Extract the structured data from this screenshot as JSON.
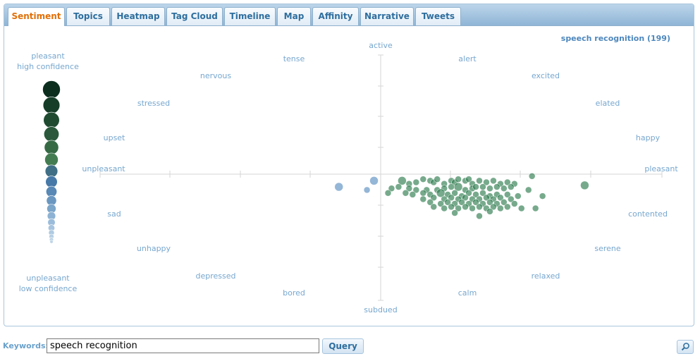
{
  "tabs": [
    {
      "label": "Sentiment",
      "active": true
    },
    {
      "label": "Topics"
    },
    {
      "label": "Heatmap"
    },
    {
      "label": "Tag Cloud"
    },
    {
      "label": "Timeline"
    },
    {
      "label": "Map"
    },
    {
      "label": "Affinity"
    },
    {
      "label": "Narrative"
    },
    {
      "label": "Tweets"
    }
  ],
  "legend": {
    "title": "speech recognition (199)",
    "top_line1": "pleasant",
    "top_line2": "high confidence",
    "bottom_line1": "unpleasant",
    "bottom_line2": "low confidence",
    "colors_pleasant_to_unpleasant": [
      "#0c2e1f",
      "#163d28",
      "#1f4b31",
      "#2a5a3b",
      "#366a45",
      "#447c52",
      "#3f6f86",
      "#4679a8",
      "#5888b5",
      "#6a97c0",
      "#7ca5ca",
      "#8db2d3",
      "#9bbddb",
      "#a6c4df",
      "#afcae2",
      "#b6cfe4",
      "#bbd2e6",
      "#bfd5e8"
    ]
  },
  "emotion_labels": {
    "active": "active",
    "subdued": "subdued",
    "pleasant": "pleasant",
    "unpleasant": "unpleasant",
    "tense": "tense",
    "nervous": "nervous",
    "stressed": "stressed",
    "upset": "upset",
    "sad": "sad",
    "unhappy": "unhappy",
    "depressed": "depressed",
    "bored": "bored",
    "alert": "alert",
    "excited": "excited",
    "elated": "elated",
    "happy": "happy",
    "contented": "contented",
    "serene": "serene",
    "relaxed": "relaxed",
    "calm": "calm"
  },
  "chart_data": {
    "type": "scatter",
    "title": "speech recognition (199)",
    "xlabel": "",
    "ylabel": "",
    "xlim": [
      1,
      9
    ],
    "ylim": [
      1,
      9
    ],
    "grid": false,
    "point_count": 199,
    "series": [
      {
        "name": "pleasant",
        "color": "#2e7d4f",
        "points": [
          [
            5.3,
            4.9,
            2
          ],
          [
            5.4,
            4.8,
            1
          ],
          [
            5.5,
            4.85,
            1
          ],
          [
            5.6,
            4.95,
            1
          ],
          [
            5.7,
            4.9,
            1
          ],
          [
            5.75,
            4.85,
            1
          ],
          [
            5.8,
            4.95,
            1
          ],
          [
            5.9,
            4.8,
            1
          ],
          [
            6.0,
            4.9,
            1
          ],
          [
            6.05,
            4.85,
            1
          ],
          [
            6.1,
            4.95,
            1
          ],
          [
            6.2,
            4.9,
            1
          ],
          [
            6.25,
            4.95,
            1
          ],
          [
            6.3,
            4.8,
            1
          ],
          [
            6.4,
            4.9,
            1
          ],
          [
            6.5,
            4.85,
            1
          ],
          [
            6.6,
            4.9,
            1
          ],
          [
            6.7,
            4.8,
            1
          ],
          [
            6.8,
            4.85,
            1
          ],
          [
            6.9,
            4.8,
            1
          ],
          [
            5.9,
            4.65,
            1
          ],
          [
            6.0,
            4.7,
            1
          ],
          [
            6.1,
            4.7,
            2
          ],
          [
            6.2,
            4.6,
            1
          ],
          [
            6.3,
            4.65,
            1
          ],
          [
            6.35,
            4.7,
            1
          ],
          [
            6.45,
            4.7,
            1
          ],
          [
            6.55,
            4.65,
            1
          ],
          [
            6.65,
            4.7,
            1
          ],
          [
            6.75,
            4.65,
            1
          ],
          [
            6.85,
            4.7,
            1
          ],
          [
            5.8,
            4.6,
            1
          ],
          [
            5.65,
            4.6,
            1
          ],
          [
            5.5,
            4.6,
            1
          ],
          [
            5.4,
            4.65,
            1
          ],
          [
            5.25,
            4.7,
            1
          ],
          [
            5.15,
            4.65,
            1
          ],
          [
            5.1,
            4.5,
            1
          ],
          [
            5.35,
            4.5,
            1
          ],
          [
            5.45,
            4.45,
            1
          ],
          [
            5.6,
            4.5,
            1
          ],
          [
            5.7,
            4.45,
            1
          ],
          [
            5.85,
            4.5,
            2
          ],
          [
            5.95,
            4.45,
            1
          ],
          [
            6.05,
            4.5,
            1
          ],
          [
            6.15,
            4.4,
            1
          ],
          [
            6.25,
            4.5,
            1
          ],
          [
            6.35,
            4.45,
            1
          ],
          [
            6.45,
            4.5,
            1
          ],
          [
            6.55,
            4.4,
            1
          ],
          [
            6.65,
            4.45,
            1
          ],
          [
            6.8,
            4.45,
            1
          ],
          [
            6.95,
            4.4,
            1
          ],
          [
            5.75,
            4.35,
            1
          ],
          [
            5.9,
            4.3,
            1
          ],
          [
            6.0,
            4.35,
            1
          ],
          [
            6.1,
            4.3,
            1
          ],
          [
            6.2,
            4.35,
            1
          ],
          [
            6.3,
            4.3,
            1
          ],
          [
            6.4,
            4.3,
            1
          ],
          [
            6.5,
            4.35,
            1
          ],
          [
            6.6,
            4.3,
            1
          ],
          [
            6.7,
            4.35,
            1
          ],
          [
            6.85,
            4.3,
            1
          ],
          [
            5.7,
            4.2,
            1
          ],
          [
            5.85,
            4.15,
            1
          ],
          [
            5.95,
            4.2,
            1
          ],
          [
            6.05,
            4.15,
            1
          ],
          [
            6.15,
            4.2,
            1
          ],
          [
            6.25,
            4.15,
            1
          ],
          [
            6.35,
            4.2,
            1
          ],
          [
            6.45,
            4.15,
            1
          ],
          [
            6.55,
            4.2,
            1
          ],
          [
            6.65,
            4.15,
            1
          ],
          [
            6.75,
            4.2,
            1
          ],
          [
            6.9,
            4.15,
            1
          ],
          [
            5.75,
            4.05,
            1
          ],
          [
            5.9,
            4.0,
            1
          ],
          [
            6.0,
            4.05,
            1
          ],
          [
            6.1,
            4.0,
            1
          ],
          [
            6.2,
            4.05,
            1
          ],
          [
            6.3,
            4.0,
            1
          ],
          [
            6.4,
            4.05,
            1
          ],
          [
            6.5,
            4.0,
            1
          ],
          [
            6.6,
            4.05,
            1
          ],
          [
            6.7,
            4.0,
            1
          ],
          [
            6.8,
            4.05,
            1
          ],
          [
            7.0,
            4.0,
            1
          ],
          [
            7.2,
            4.0,
            1
          ],
          [
            7.3,
            4.4,
            1
          ],
          [
            7.1,
            4.6,
            1
          ],
          [
            7.9,
            4.75,
            2
          ],
          [
            7.15,
            5.05,
            1
          ],
          [
            6.05,
            3.85,
            1
          ],
          [
            6.4,
            3.75,
            1
          ],
          [
            6.55,
            3.9,
            1
          ],
          [
            5.6,
            4.3,
            1
          ]
        ]
      },
      {
        "name": "unpleasant",
        "color": "#5a8fc1",
        "points": [
          [
            4.9,
            4.9,
            2
          ],
          [
            4.4,
            4.7,
            2
          ],
          [
            4.8,
            4.6,
            1
          ]
        ]
      }
    ]
  },
  "footer": {
    "keywords_label": "Keywords:",
    "keywords_value": "speech recognition",
    "query_label": "Query"
  }
}
